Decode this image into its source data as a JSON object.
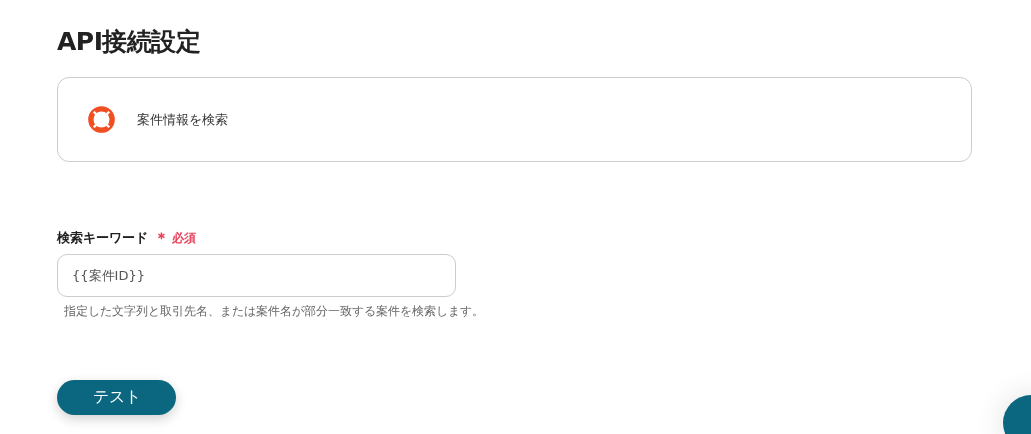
{
  "title": "API接続設定",
  "action": {
    "label": "案件情報を検索"
  },
  "field": {
    "label": "検索キーワード",
    "required_mark": "＊",
    "required_text": "必須",
    "required": true,
    "value": "{{案件ID}}",
    "help": "指定した文字列と取引先名、または案件名が部分一致する案件を検索します。"
  },
  "buttons": [
    "テスト"
  ]
}
